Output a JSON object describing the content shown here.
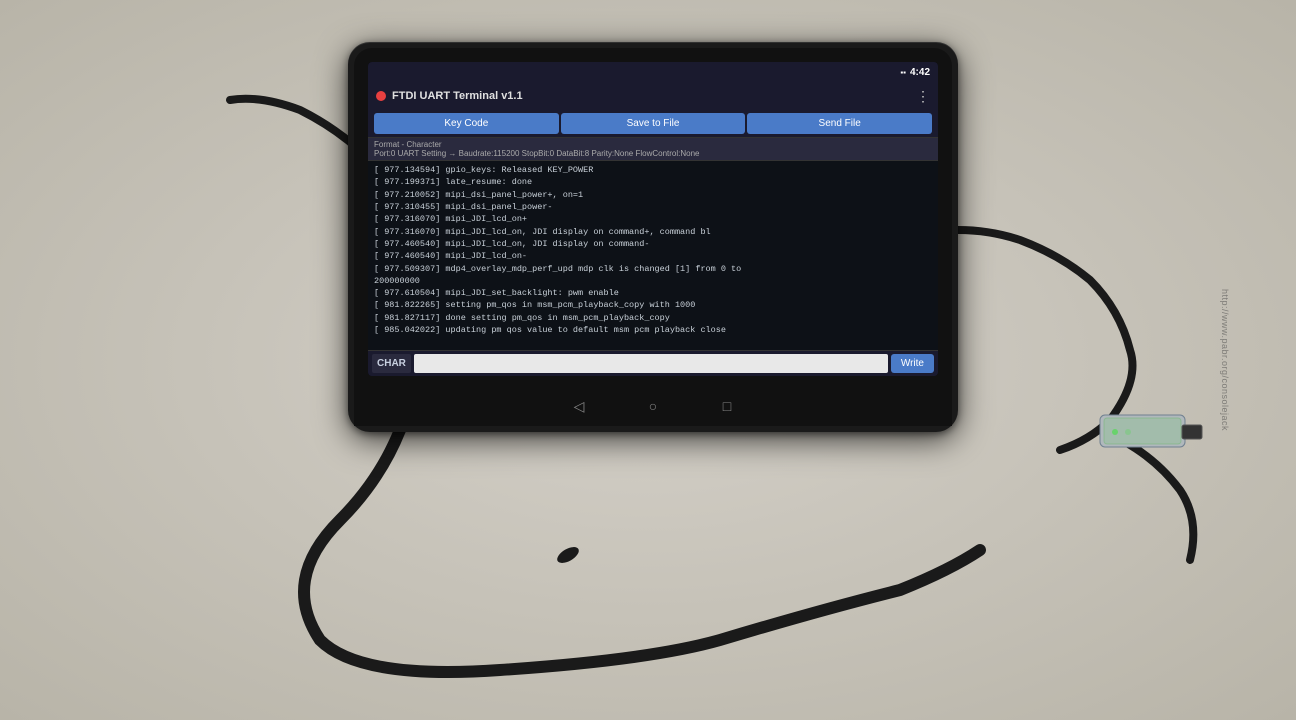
{
  "surface": {
    "background": "#c8c4b8"
  },
  "status_bar": {
    "time": "4:42",
    "battery_icon": "🔋",
    "signal_icon": "▪"
  },
  "app": {
    "title": "FTDI UART Terminal v1.1",
    "menu_icon": "⋮",
    "toolbar": {
      "key_code_label": "Key Code",
      "save_to_file_label": "Save to File",
      "send_file_label": "Send File"
    },
    "format_bar": {
      "text": "Format - Character",
      "port_info": "Port:0  UART Setting →  Baudrate:115200  StopBit:0  DataBit:8  Parity:None  FlowControl:None"
    },
    "terminal_lines": [
      "[  977.134594] gpio_keys: Released KEY_POWER",
      "[  977.199371] late_resume: done",
      "[  977.210052] mipi_dsi_panel_power+, on=1",
      "[  977.310455] mipi_dsi_panel_power-",
      "[  977.316070] mipi_JDI_lcd_on+",
      "[  977.316070] mipi_JDI_lcd_on, JDI display on command+, command bl",
      "[  977.460540] mipi_JDI_lcd_on, JDI display on command-",
      "[  977.460540] mipi_JDI_lcd_on-",
      "[  977.509307] mdp4_overlay_mdp_perf_upd mdp clk is changed [1] from 0 to",
      "200000000",
      "[  977.610504] mipi_JDI_set_backlight: pwm enable",
      "[  981.822265] setting pm_qos in msm_pcm_playback_copy with 1000",
      "[  981.827117] done setting pm_qos in msm_pcm_playback_copy",
      "[  985.042022] updating pm qos value to default msm pcm playback close"
    ],
    "input": {
      "label": "CHAR",
      "placeholder": "",
      "value": "",
      "write_button_label": "Write"
    }
  },
  "android_nav": {
    "back_icon": "◁",
    "home_icon": "○",
    "recents_icon": "□"
  },
  "watermark": {
    "text": "http://www.pabr.org/consolejack"
  }
}
